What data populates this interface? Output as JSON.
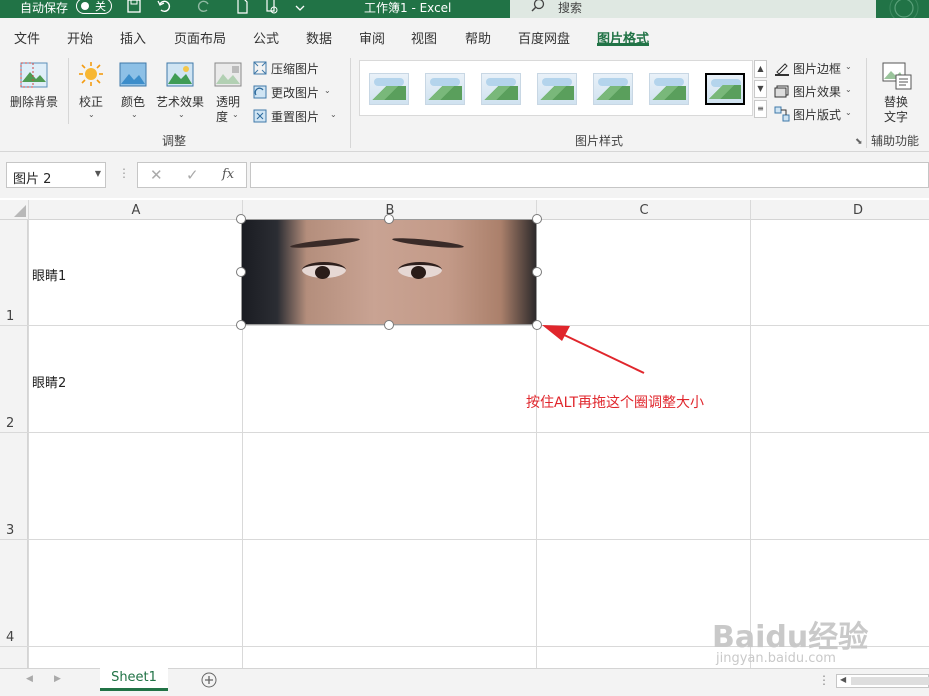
{
  "titlebar": {
    "autosave_label": "自动保存",
    "autosave_state": "关",
    "doc_title": "工作簿1  -  Excel",
    "search_placeholder": "搜索"
  },
  "tabs": [
    {
      "label": "文件"
    },
    {
      "label": "开始"
    },
    {
      "label": "插入"
    },
    {
      "label": "页面布局"
    },
    {
      "label": "公式"
    },
    {
      "label": "数据"
    },
    {
      "label": "审阅"
    },
    {
      "label": "视图"
    },
    {
      "label": "帮助"
    },
    {
      "label": "百度网盘"
    },
    {
      "label": "图片格式",
      "active": true
    }
  ],
  "ribbon": {
    "remove_bg": "删除背景",
    "corrections": "校正",
    "color": "颜色",
    "artistic": "艺术效果",
    "transparency_1": "透明",
    "transparency_2": "度",
    "compress": "压缩图片",
    "change": "更改图片",
    "reset": "重置图片",
    "group_adjust": "调整",
    "group_styles": "图片样式",
    "border": "图片边框",
    "effects": "图片效果",
    "layout": "图片版式",
    "alt_text_1": "替换",
    "alt_text_2": "文字",
    "group_access": "辅助功能"
  },
  "formula_bar": {
    "name_box": "图片 2",
    "fx": "fx",
    "formula": ""
  },
  "columns": [
    "A",
    "B",
    "C",
    "D"
  ],
  "rows": [
    "1",
    "2",
    "3",
    "4"
  ],
  "cells": {
    "A1": "眼睛1",
    "A2": "眼睛2"
  },
  "annotation": "按住ALT再拖这个圈调整大小",
  "annotation_color": "#e0262c",
  "sheet_tab": "Sheet1",
  "watermark": {
    "line1": "Baidu经验",
    "line2": "jingyan.baidu.com"
  },
  "accent_color": "#217346"
}
